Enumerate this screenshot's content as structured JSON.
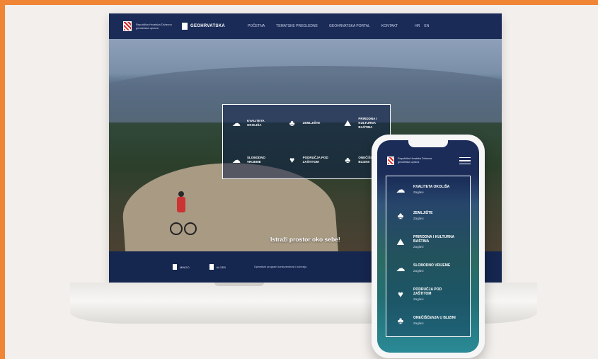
{
  "laptop": {
    "brand": "Republika Hrvatska Državna geodetska uprava",
    "product": "GEOHRVATSKA",
    "menu": [
      "Početna",
      "Tematske pregledne",
      "Geohrvatska portal",
      "Kontakt"
    ],
    "lang": [
      "HR",
      "EN"
    ],
    "grid": [
      {
        "icon": "leaf-cloud-icon",
        "glyph": "☁",
        "label": "Kvaliteta okoliša"
      },
      {
        "icon": "hand-trees-icon",
        "glyph": "♣",
        "label": "Zemljište"
      },
      {
        "icon": "mountain-icon",
        "glyph": "⛰",
        "label": "Prirodna i kulturna baština"
      },
      {
        "icon": "wind-hand-icon",
        "glyph": "☁",
        "label": "Slobodno vrijeme"
      },
      {
        "icon": "hand-leaf-icon",
        "glyph": "♥",
        "label": "Područja pod zaštitom"
      },
      {
        "icon": "tree-hand-icon",
        "glyph": "♣",
        "label": "Onečišćenja u blizini"
      }
    ],
    "tagline": "Istraži prostor oko sebe!",
    "footer": {
      "logo1": "MINGO",
      "logo2": "ALGEB",
      "text": "Operativni program konkurentnost i kohezija"
    }
  },
  "phone": {
    "brand": "Republika Hrvatska Državna geodetska uprava",
    "items": [
      {
        "icon": "leaf-cloud-icon",
        "glyph": "☁",
        "label": "Kvaliteta okoliša",
        "link": "Zaglavi"
      },
      {
        "icon": "hand-trees-icon",
        "glyph": "♣",
        "label": "Zemljište",
        "link": "Zaglavi"
      },
      {
        "icon": "mountain-icon",
        "glyph": "⛰",
        "label": "Prirodna i kulturna baština",
        "link": "Zaglavi"
      },
      {
        "icon": "wind-hand-icon",
        "glyph": "☁",
        "label": "Slobodno vrijeme",
        "link": "Zaglavi"
      },
      {
        "icon": "hand-leaf-icon",
        "glyph": "♥",
        "label": "Područja pod zaštitom",
        "link": "Zaglavi"
      },
      {
        "icon": "tree-hand-icon",
        "glyph": "♣",
        "label": "Onečišćenja u blizini",
        "link": "Zaglavi"
      }
    ]
  }
}
